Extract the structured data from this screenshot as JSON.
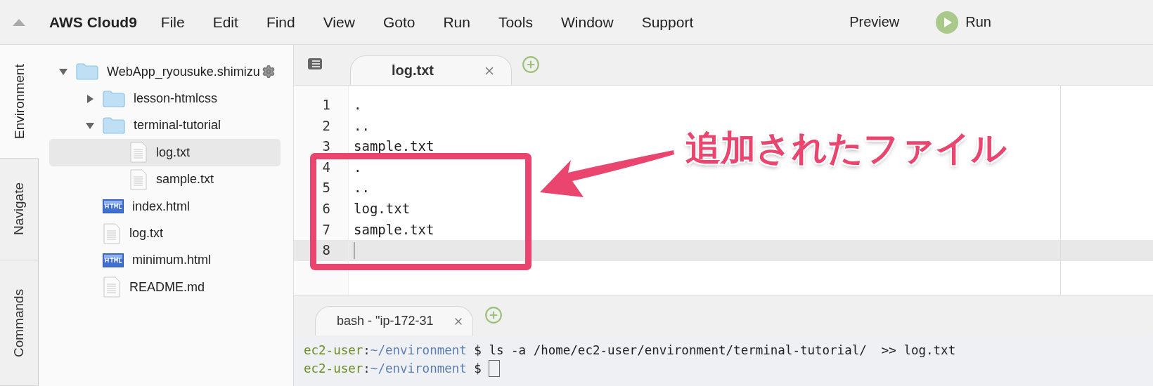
{
  "menu_bar": {
    "brand": "AWS Cloud9",
    "items": [
      "File",
      "Edit",
      "Find",
      "View",
      "Goto",
      "Run",
      "Tools",
      "Window",
      "Support"
    ],
    "preview": "Preview",
    "run": "Run"
  },
  "side_tabs": [
    {
      "label": "Environment",
      "selected": true
    },
    {
      "label": "Navigate",
      "selected": false
    },
    {
      "label": "Commands",
      "selected": false
    }
  ],
  "tree": [
    {
      "name": "WebApp_ryousuke.shimizu",
      "kind": "folder",
      "expanded": true,
      "selected": false,
      "children": [
        {
          "name": "lesson-htmlcss",
          "kind": "folder",
          "expanded": false,
          "selected": false
        },
        {
          "name": "terminal-tutorial",
          "kind": "folder",
          "expanded": true,
          "selected": false,
          "children": [
            {
              "name": "log.txt",
              "kind": "text",
              "selected": true
            },
            {
              "name": "sample.txt",
              "kind": "text",
              "selected": false
            }
          ]
        },
        {
          "name": "index.html",
          "kind": "html",
          "selected": false
        },
        {
          "name": "log.txt",
          "kind": "text",
          "selected": false
        },
        {
          "name": "minimum.html",
          "kind": "html",
          "selected": false
        },
        {
          "name": "README.md",
          "kind": "text",
          "selected": false
        }
      ]
    }
  ],
  "editor": {
    "tabs": [
      {
        "label": "log.txt",
        "selected": true
      }
    ],
    "lines": [
      {
        "number": "1",
        "text": ".",
        "current": false
      },
      {
        "number": "2",
        "text": "..",
        "current": false
      },
      {
        "number": "3",
        "text": "sample.txt",
        "current": false
      },
      {
        "number": "4",
        "text": ".",
        "current": false
      },
      {
        "number": "5",
        "text": "..",
        "current": false
      },
      {
        "number": "6",
        "text": "log.txt",
        "current": false
      },
      {
        "number": "7",
        "text": "sample.txt",
        "current": false
      },
      {
        "number": "8",
        "current": true
      }
    ]
  },
  "annotation": {
    "label": "追加されたファイル"
  },
  "terminal": {
    "tabs": [
      {
        "label": "bash - \"ip-172-31",
        "selected": true
      }
    ],
    "lines": [
      {
        "user": "ec2-user",
        "separator": ":",
        "path": "~/environment",
        "prompt": "$",
        "command": "ls -a /home/ec2-user/environment/terminal-tutorial/  >> log.txt"
      },
      {
        "user": "ec2-user",
        "separator": ":",
        "path": "~/environment",
        "prompt": "$",
        "cursor": true
      }
    ]
  }
}
